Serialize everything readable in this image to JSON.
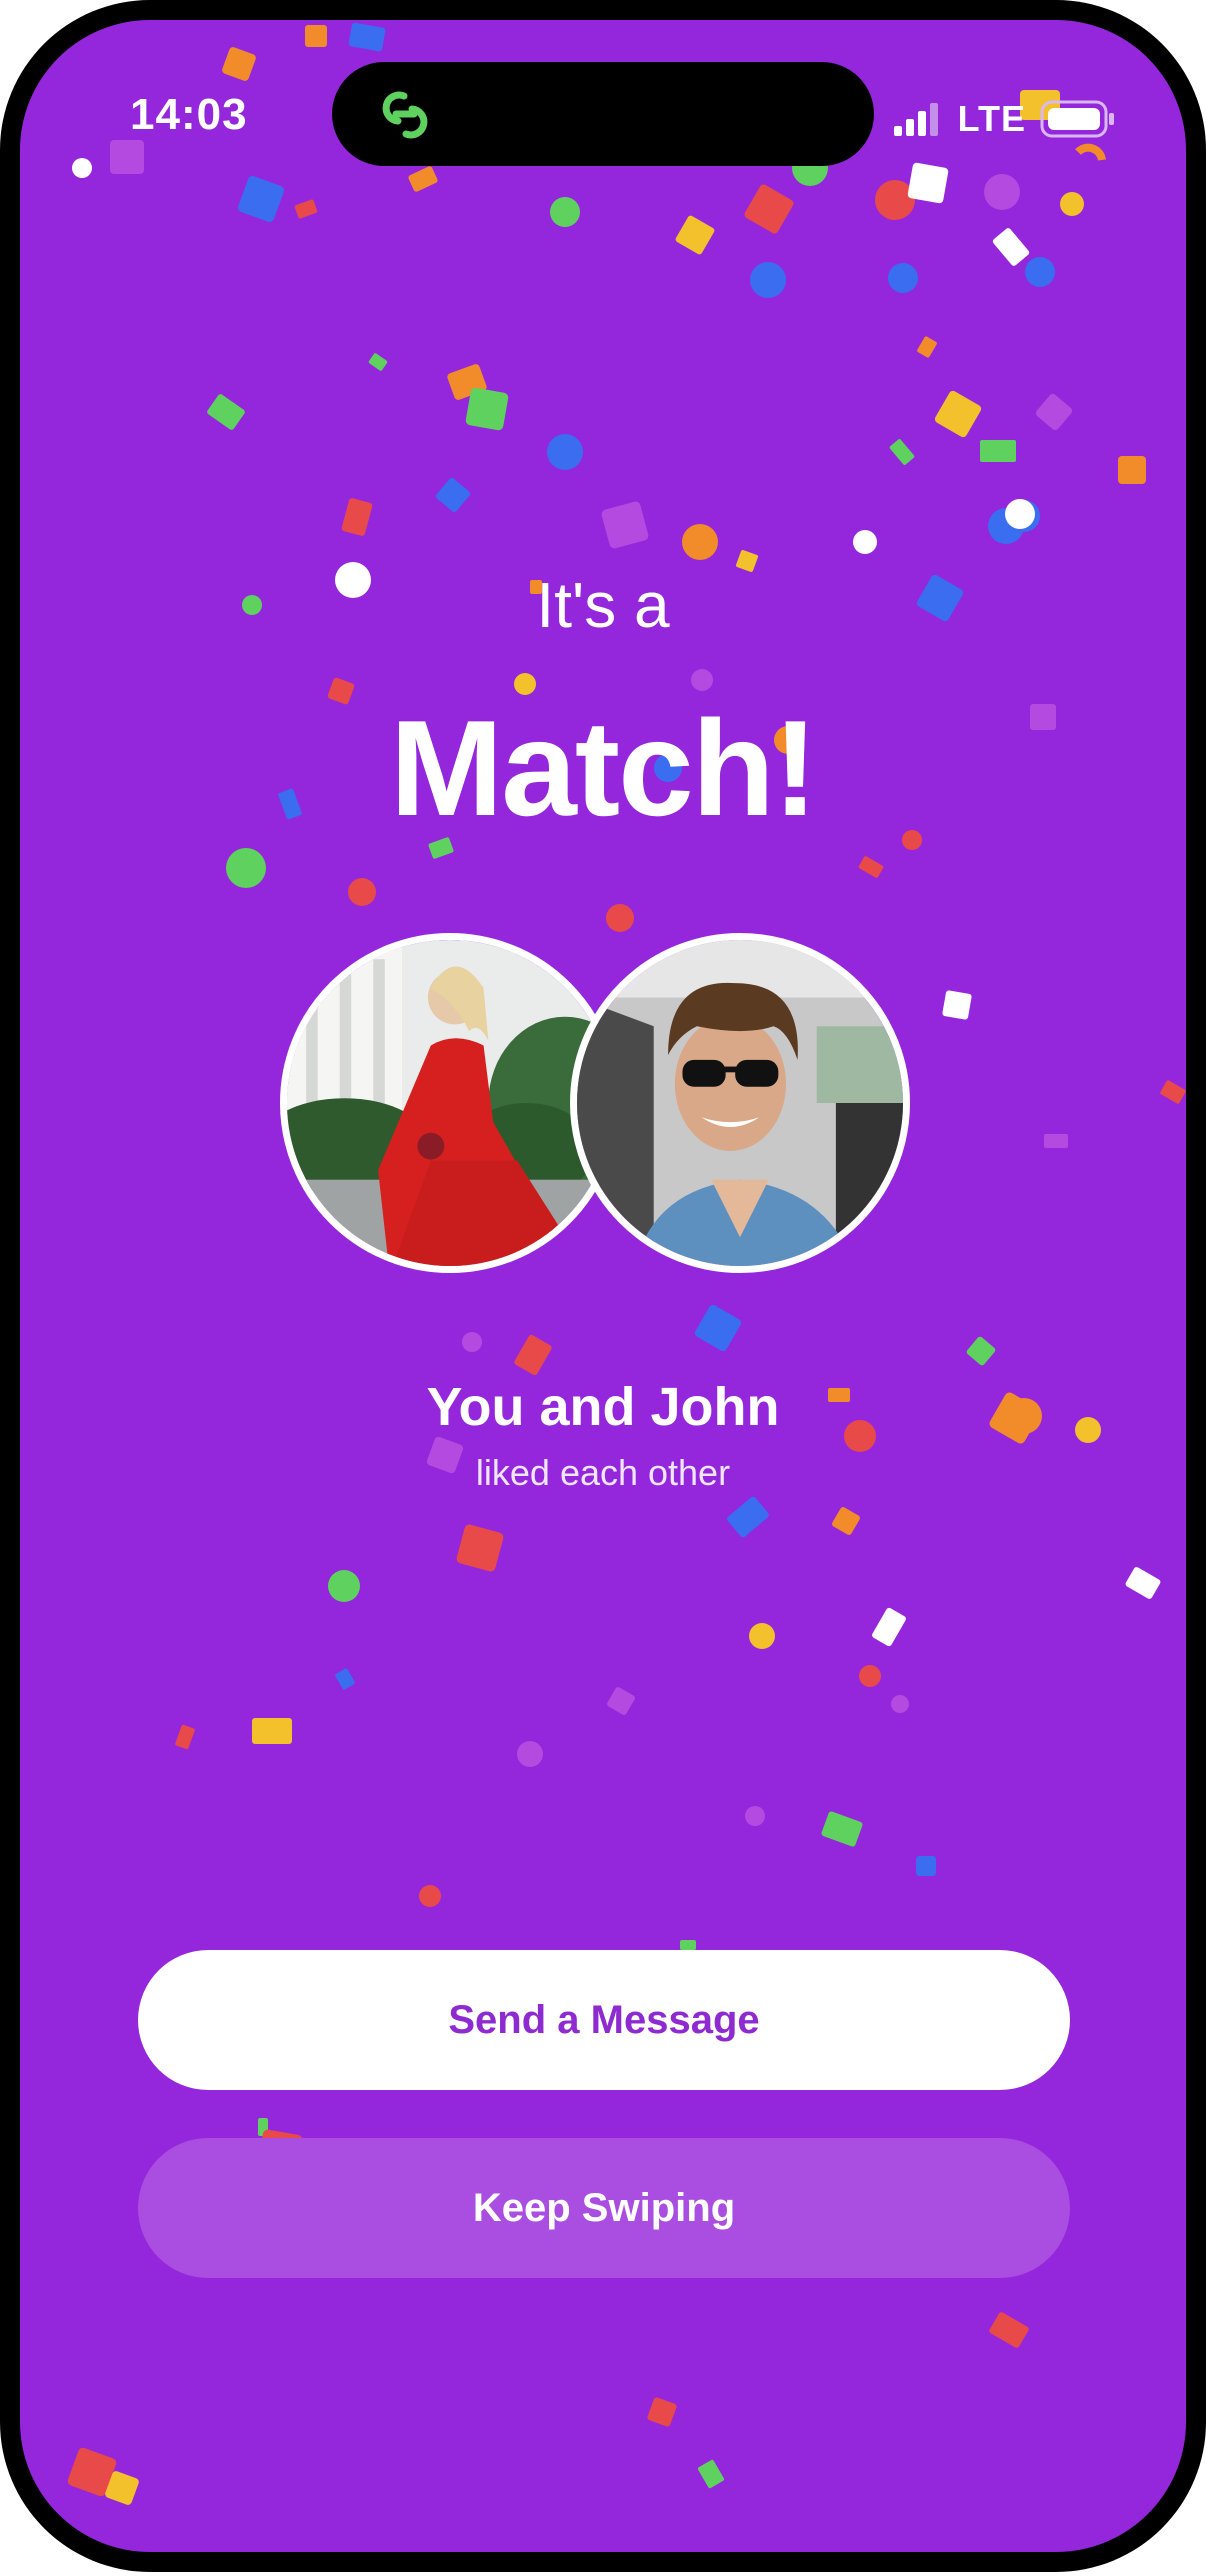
{
  "status_bar": {
    "time": "14:03",
    "network": "LTE"
  },
  "match": {
    "title_small": "It's a",
    "title_big": "Match!",
    "names": "You and John",
    "subtitle": "liked each other"
  },
  "actions": {
    "primary_label": "Send a Message",
    "secondary_label": "Keep Swiping"
  },
  "colors": {
    "background": "#9426dc",
    "primary_button_text": "#8e2bd0",
    "secondary_button_bg": "#a94ee0",
    "accent_green": "#5fd15f"
  }
}
